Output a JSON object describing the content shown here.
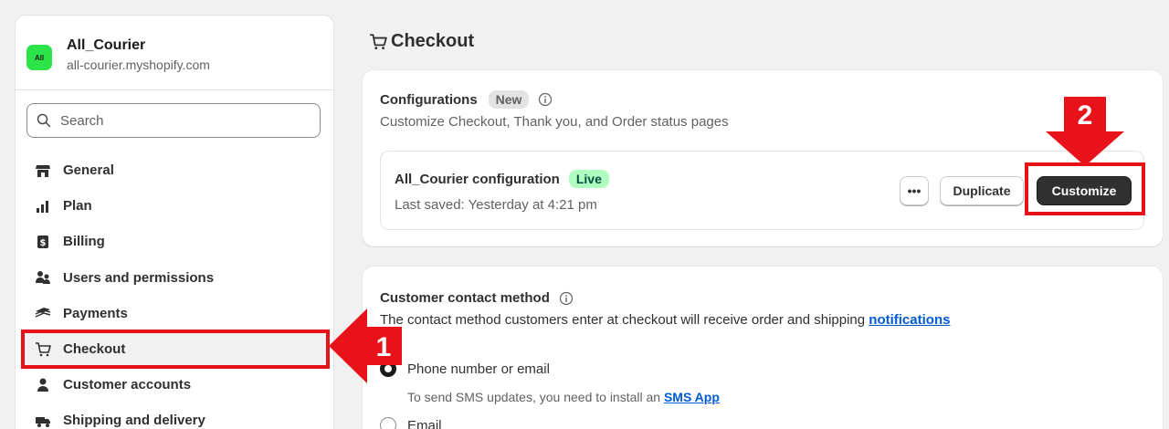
{
  "store": {
    "avatar_text": "All",
    "name": "All_Courier",
    "domain": "all-courier.myshopify.com"
  },
  "search": {
    "placeholder": "Search"
  },
  "sidebar": {
    "items": [
      {
        "label": "General",
        "icon": "store-icon"
      },
      {
        "label": "Plan",
        "icon": "plan-icon"
      },
      {
        "label": "Billing",
        "icon": "billing-icon"
      },
      {
        "label": "Users and permissions",
        "icon": "users-icon"
      },
      {
        "label": "Payments",
        "icon": "payments-icon"
      },
      {
        "label": "Checkout",
        "icon": "cart-icon",
        "active": true
      },
      {
        "label": "Customer accounts",
        "icon": "person-icon"
      },
      {
        "label": "Shipping and delivery",
        "icon": "truck-icon"
      }
    ]
  },
  "page": {
    "title": "Checkout"
  },
  "configurations": {
    "title": "Configurations",
    "badge": "New",
    "description": "Customize Checkout, Thank you, and Order status pages",
    "config": {
      "name": "All_Courier configuration",
      "status": "Live",
      "last_saved": "Last saved: Yesterday at 4:21 pm",
      "more_label": "•••",
      "duplicate_label": "Duplicate",
      "customize_label": "Customize"
    }
  },
  "contact": {
    "title": "Customer contact method",
    "description_prefix": "The contact method customers enter at checkout will receive order and shipping ",
    "description_link": "notifications",
    "options": [
      {
        "label": "Phone number or email",
        "selected": true
      },
      {
        "label": "Email",
        "selected": false
      }
    ],
    "sms_help_prefix": "To send SMS updates, you need to install an ",
    "sms_help_link": "SMS App"
  },
  "annotations": {
    "step1": "1",
    "step2": "2"
  },
  "colors": {
    "annotation_red": "#e8121a",
    "primary_button": "#303030",
    "live_badge": "#affebf",
    "link": "#005bd3",
    "store_avatar": "#2de34a"
  }
}
